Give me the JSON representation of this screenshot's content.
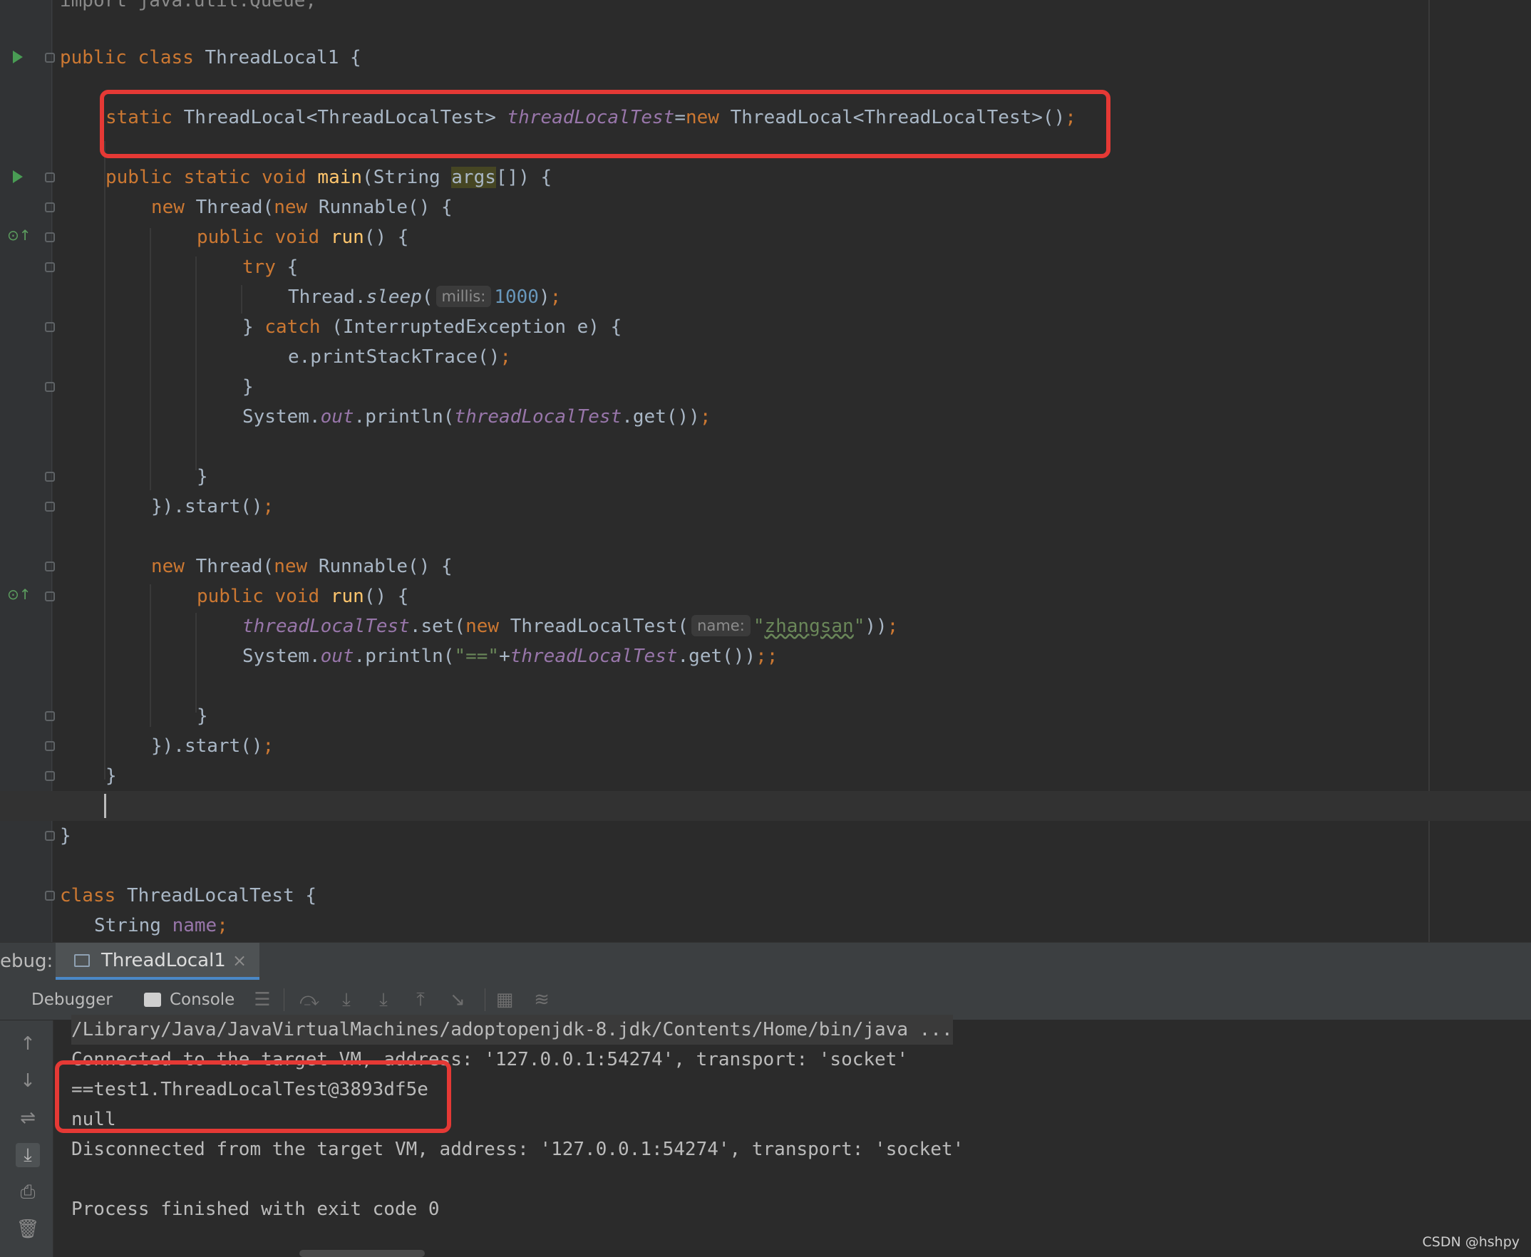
{
  "editor": {
    "lines": {
      "l_import": "import java.util.Queue;",
      "l1_public": "public",
      "l1_class": "class",
      "l1_name": "ThreadLocal1",
      "l1_brace": "{",
      "l3_static": "static",
      "l3_type": "ThreadLocal<ThreadLocalTest>",
      "l3_field": "threadLocalTest",
      "l3_eq": "=",
      "l3_new": "new",
      "l3_ctor": "ThreadLocal<ThreadLocalTest>()",
      "l3_semi": ";",
      "l5_mods": "public static void",
      "l5_main": "main",
      "l5_open": "(String ",
      "l5_args": "args",
      "l5_close": "[]) {",
      "l6_new": "new",
      "l6_thread": "Thread(",
      "l6_new2": "new",
      "l6_rest": "Runnable() {",
      "l7_mods": "public void",
      "l7_run": "run",
      "l7_rest": "() {",
      "l8_try": "try",
      "l8_rest": "{",
      "l9_thread": "Thread.",
      "l9_sleep": "sleep",
      "l9_open": "(",
      "l9_hint": "millis:",
      "l9_num": "1000",
      "l9_close": ")",
      "l9_semi": ";",
      "l10_brace": "}",
      "l10_catch": "catch",
      "l10_rest": "(InterruptedException e) {",
      "l11_call": "e.printStackTrace()",
      "l11_semi": ";",
      "l12_brace": "}",
      "l13_sys": "System.",
      "l13_out": "out",
      "l13_println": ".println(",
      "l13_field": "threadLocalTest",
      "l13_get": ".get())",
      "l13_semi": ";",
      "l15_brace": "}",
      "l16_end": "}).start()",
      "l16_semi": ";",
      "l18_new": "new",
      "l18_thread": "Thread(",
      "l18_new2": "new",
      "l18_rest": "Runnable() {",
      "l19_mods": "public void",
      "l19_run": "run",
      "l19_rest": "() {",
      "l20_field": "threadLocalTest",
      "l20_set": ".set(",
      "l20_new": "new",
      "l20_ctor": "ThreadLocalTest(",
      "l20_hint": "name:",
      "l20_q1": "\"",
      "l20_str": "zhangsan",
      "l20_q2": "\"",
      "l20_close": "))",
      "l20_semi": ";",
      "l21_sys": "System.",
      "l21_out": "out",
      "l21_println": ".println(",
      "l21_str": "\"==\"",
      "l21_plus": "+",
      "l21_field": "threadLocalTest",
      "l21_get": ".get())",
      "l21_semi": ";;",
      "l23_brace": "}",
      "l24_end": "}).start()",
      "l24_semi": ";",
      "l25_brace": "}",
      "l27_brace": "}",
      "l29_class": "class",
      "l29_name": "ThreadLocalTest {",
      "l30_type": "String",
      "l30_field": "name",
      "l30_semi": ";"
    }
  },
  "debug": {
    "label": "ebug:",
    "session_tab": "ThreadLocal1",
    "close_symbol": "×",
    "tabs": {
      "debugger": "Debugger",
      "console": "Console"
    }
  },
  "console": {
    "lines": [
      "/Library/Java/JavaVirtualMachines/adoptopenjdk-8.jdk/Contents/Home/bin/java ...",
      "Connected to the target VM, address: '127.0.0.1:54274', transport: 'socket'",
      "==test1.ThreadLocalTest@3893df5e",
      "null",
      "Disconnected from the target VM, address: '127.0.0.1:54274', transport: 'socket'",
      "",
      "Process finished with exit code 0"
    ]
  },
  "watermark": "CSDN @hshpy",
  "colors": {
    "keyword": "#cc7832",
    "method": "#ffc66d",
    "field": "#9876aa",
    "string": "#6a8759",
    "number": "#6897bb",
    "highlight_box": "#e53935"
  }
}
